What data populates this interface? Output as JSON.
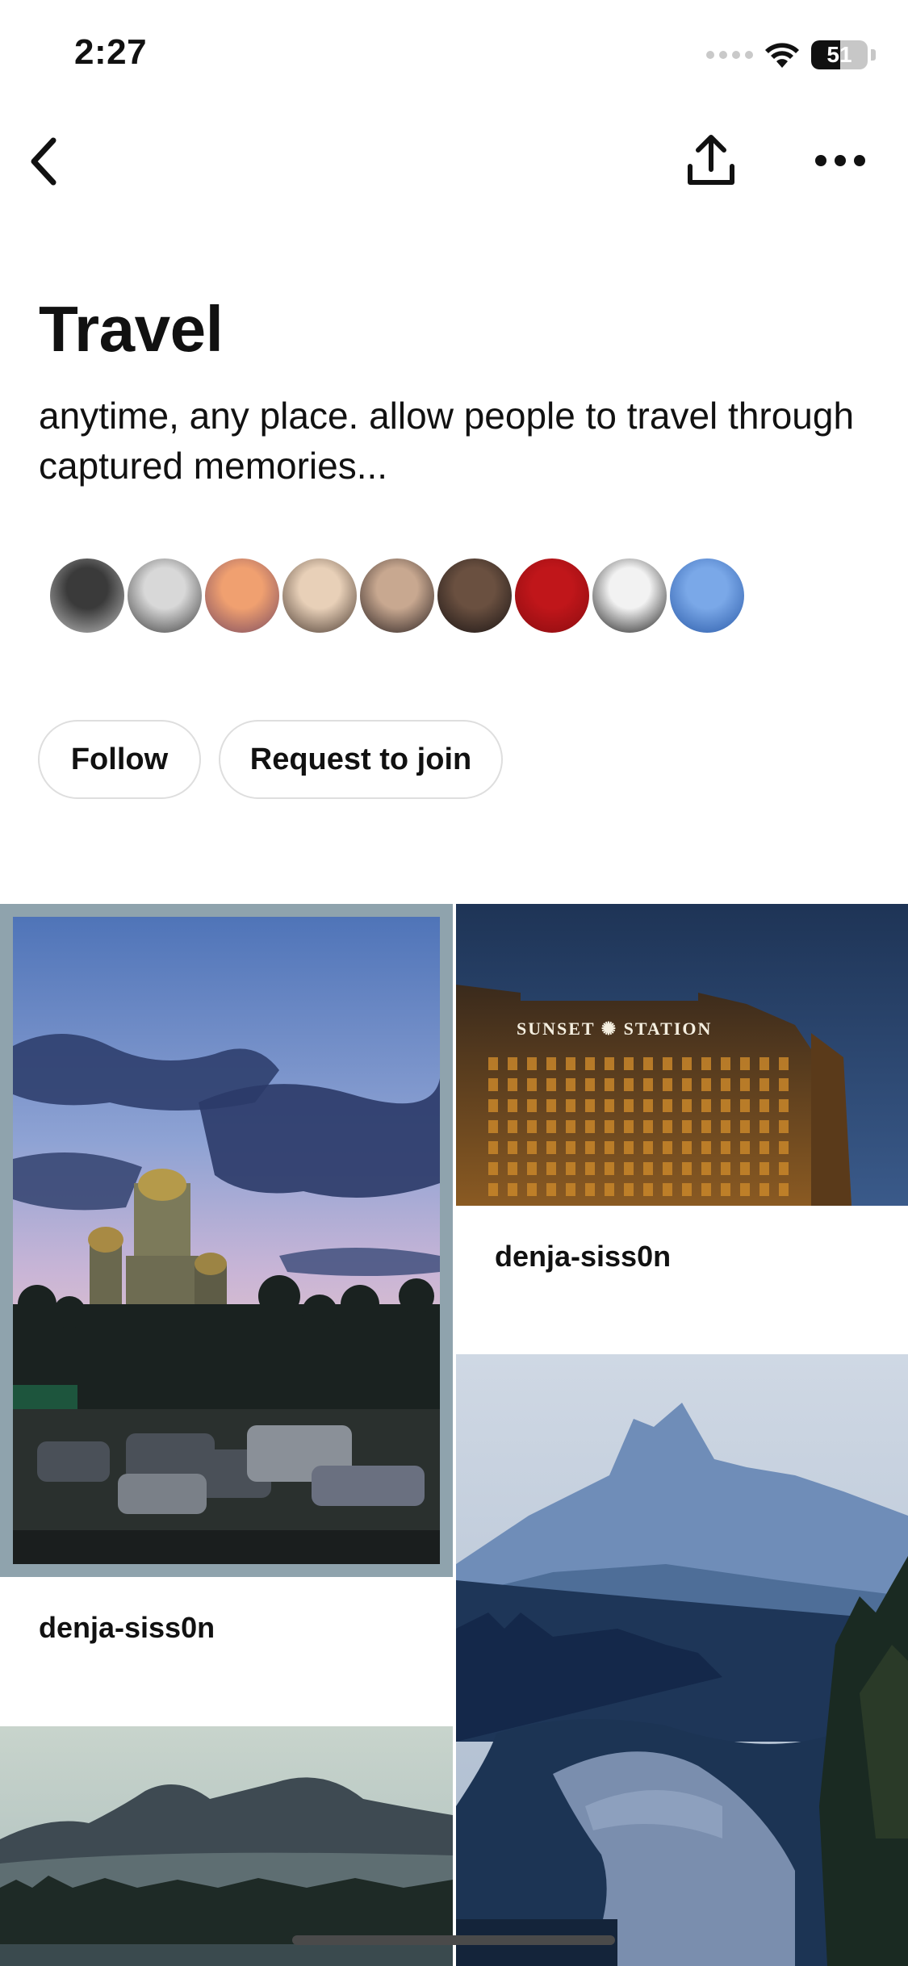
{
  "status_bar": {
    "time": "2:27",
    "battery_level": "51",
    "battery_fraction": 0.51
  },
  "nav": {
    "back_icon": "chevron-left-icon",
    "share_icon": "share-upload-icon",
    "more_icon": "ellipsis-icon"
  },
  "board": {
    "title": "Travel",
    "description": "anytime, any place. allow people to travel through captured memories..."
  },
  "collaborators": [
    {
      "name": "avatar-1",
      "colors": [
        "#3a3a3a",
        "#bdbdbd"
      ]
    },
    {
      "name": "avatar-2",
      "colors": [
        "#d8d8d8",
        "#3c3c3c"
      ]
    },
    {
      "name": "avatar-3",
      "colors": [
        "#f0a070",
        "#7a4a60"
      ]
    },
    {
      "name": "avatar-4",
      "colors": [
        "#e8d0b8",
        "#4a3a30"
      ]
    },
    {
      "name": "avatar-5",
      "colors": [
        "#c8a890",
        "#2a2020"
      ]
    },
    {
      "name": "avatar-6",
      "colors": [
        "#6a5040",
        "#1a1414"
      ]
    },
    {
      "name": "avatar-7",
      "colors": [
        "#c0161a",
        "#8a0c10"
      ]
    },
    {
      "name": "avatar-8",
      "colors": [
        "#f2f2f2",
        "#1a1a1a"
      ]
    },
    {
      "name": "avatar-9",
      "colors": [
        "#7aa8e8",
        "#2a5aa8"
      ]
    }
  ],
  "actions": {
    "follow_label": "Follow",
    "join_label": "Request to join"
  },
  "pins": {
    "pin1": {
      "username": "denja-siss0n",
      "image": "palace at dusk with palm trees and parked cars"
    },
    "pin2": {
      "username": "denja-siss0n",
      "image": "hotel facade at night",
      "sign_text": "SUNSET ✺ STATION"
    },
    "pin3": {
      "image": "mountain lake at dusk"
    },
    "pin4": {
      "image": "mountain ridge over forest"
    }
  }
}
